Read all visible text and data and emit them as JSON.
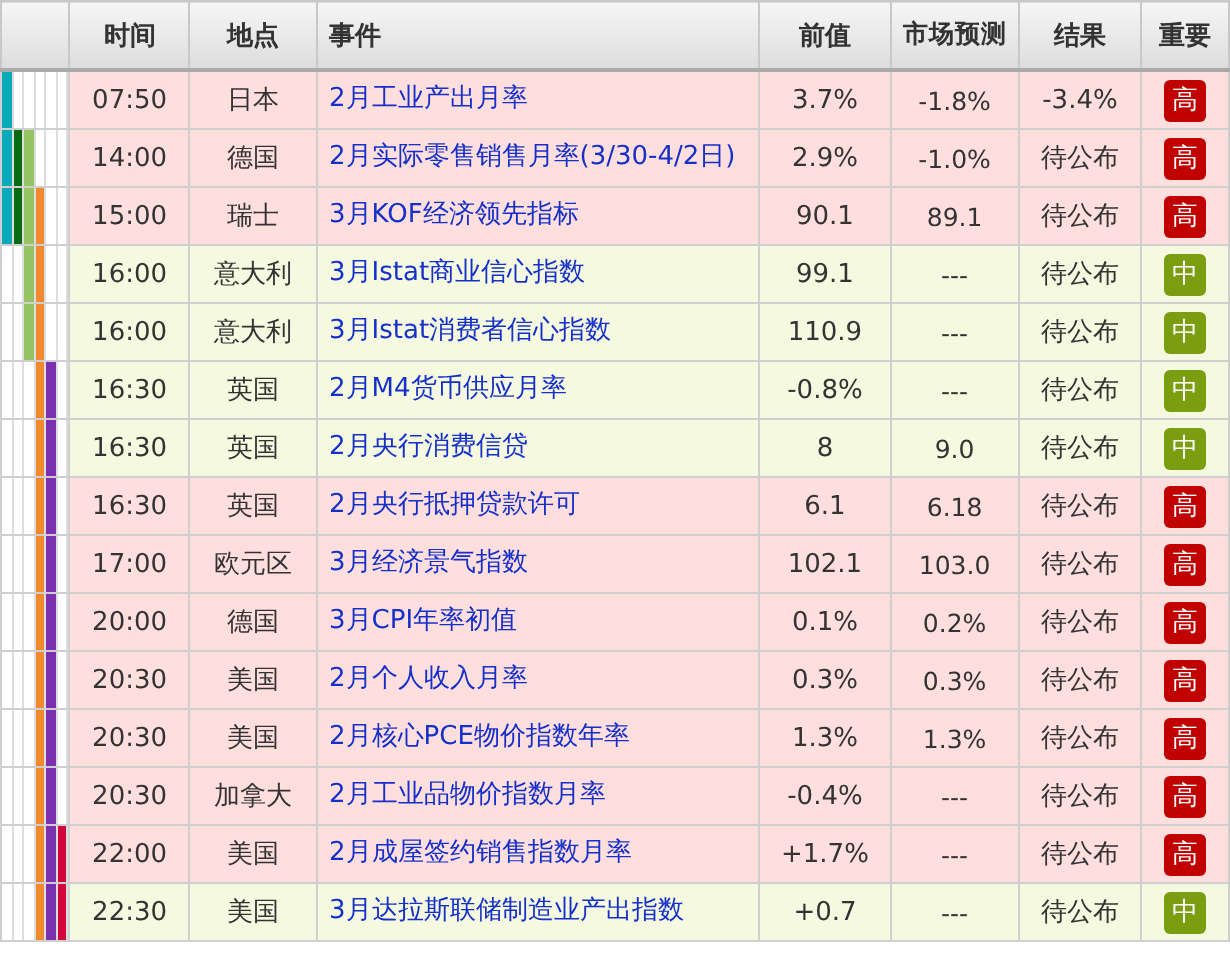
{
  "columns": [
    "时间",
    "地点",
    "事件",
    "前值",
    "市场预测",
    "结果",
    "重要"
  ],
  "lanes": [
    {
      "color": "#0aa9b9"
    },
    {
      "color": "#0b6b10"
    },
    {
      "color": "#97c462"
    },
    {
      "color": "#f08a2c"
    },
    {
      "color": "#7b30b0"
    },
    {
      "color": "#d0063c"
    }
  ],
  "rows": [
    {
      "lanes": [
        {
          "on": true
        },
        {
          "on": false
        },
        {
          "on": false
        },
        {
          "on": false
        },
        {
          "on": false
        },
        {
          "on": false
        }
      ],
      "time": "07:50",
      "place": "日本",
      "event": "2月工业产出月率",
      "previous": "3.7%",
      "forecast": "-1.8%",
      "result": "-3.4%",
      "importance": "高",
      "kind": "high"
    },
    {
      "lanes": [
        {
          "on": true
        },
        {
          "on": true
        },
        {
          "on": true
        },
        {
          "on": false
        },
        {
          "on": false
        },
        {
          "on": false
        }
      ],
      "time": "14:00",
      "place": "德国",
      "event": "2月实际零售销售月率(3/30-4/2日)",
      "previous": "2.9%",
      "forecast": "-1.0%",
      "result": "待公布",
      "importance": "高",
      "kind": "high"
    },
    {
      "lanes": [
        {
          "on": true
        },
        {
          "on": true
        },
        {
          "on": true
        },
        {
          "on": true
        },
        {
          "on": false
        },
        {
          "on": false
        }
      ],
      "time": "15:00",
      "place": "瑞士",
      "event": "3月KOF经济领先指标",
      "previous": "90.1",
      "forecast": "89.1",
      "result": "待公布",
      "importance": "高",
      "kind": "high"
    },
    {
      "lanes": [
        {
          "on": false
        },
        {
          "on": false
        },
        {
          "on": true
        },
        {
          "on": true
        },
        {
          "on": false
        },
        {
          "on": false
        }
      ],
      "time": "16:00",
      "place": "意大利",
      "event": "3月Istat商业信心指数",
      "previous": "99.1",
      "forecast": "---",
      "result": "待公布",
      "importance": "中",
      "kind": "medium"
    },
    {
      "lanes": [
        {
          "on": false
        },
        {
          "on": false
        },
        {
          "on": true
        },
        {
          "on": true
        },
        {
          "on": false
        },
        {
          "on": false
        }
      ],
      "time": "16:00",
      "place": "意大利",
      "event": "3月Istat消费者信心指数",
      "previous": "110.9",
      "forecast": "---",
      "result": "待公布",
      "importance": "中",
      "kind": "medium"
    },
    {
      "lanes": [
        {
          "on": false
        },
        {
          "on": false
        },
        {
          "on": false
        },
        {
          "on": true
        },
        {
          "on": true
        },
        {
          "on": false
        }
      ],
      "time": "16:30",
      "place": "英国",
      "event": "2月M4货币供应月率",
      "previous": "-0.8%",
      "forecast": "---",
      "result": "待公布",
      "importance": "中",
      "kind": "medium"
    },
    {
      "lanes": [
        {
          "on": false
        },
        {
          "on": false
        },
        {
          "on": false
        },
        {
          "on": true
        },
        {
          "on": true
        },
        {
          "on": false
        }
      ],
      "time": "16:30",
      "place": "英国",
      "event": "2月央行消费信贷",
      "previous": "8",
      "forecast": "9.0",
      "result": "待公布",
      "importance": "中",
      "kind": "medium"
    },
    {
      "lanes": [
        {
          "on": false
        },
        {
          "on": false
        },
        {
          "on": false
        },
        {
          "on": true
        },
        {
          "on": true
        },
        {
          "on": false
        }
      ],
      "time": "16:30",
      "place": "英国",
      "event": "2月央行抵押贷款许可",
      "previous": "6.1",
      "forecast": "6.18",
      "result": "待公布",
      "importance": "高",
      "kind": "high"
    },
    {
      "lanes": [
        {
          "on": false
        },
        {
          "on": false
        },
        {
          "on": false
        },
        {
          "on": true
        },
        {
          "on": true
        },
        {
          "on": false
        }
      ],
      "time": "17:00",
      "place": "欧元区",
      "event": "3月经济景气指数",
      "previous": "102.1",
      "forecast": "103.0",
      "result": "待公布",
      "importance": "高",
      "kind": "high"
    },
    {
      "lanes": [
        {
          "on": false
        },
        {
          "on": false
        },
        {
          "on": false
        },
        {
          "on": true
        },
        {
          "on": true
        },
        {
          "on": false
        }
      ],
      "time": "20:00",
      "place": "德国",
      "event": "3月CPI年率初值",
      "previous": "0.1%",
      "forecast": "0.2%",
      "result": "待公布",
      "importance": "高",
      "kind": "high"
    },
    {
      "lanes": [
        {
          "on": false
        },
        {
          "on": false
        },
        {
          "on": false
        },
        {
          "on": true
        },
        {
          "on": true
        },
        {
          "on": false
        }
      ],
      "time": "20:30",
      "place": "美国",
      "event": "2月个人收入月率",
      "previous": "0.3%",
      "forecast": "0.3%",
      "result": "待公布",
      "importance": "高",
      "kind": "high"
    },
    {
      "lanes": [
        {
          "on": false
        },
        {
          "on": false
        },
        {
          "on": false
        },
        {
          "on": true
        },
        {
          "on": true
        },
        {
          "on": false
        }
      ],
      "time": "20:30",
      "place": "美国",
      "event": "2月核心PCE物价指数年率",
      "previous": "1.3%",
      "forecast": "1.3%",
      "result": "待公布",
      "importance": "高",
      "kind": "high"
    },
    {
      "lanes": [
        {
          "on": false
        },
        {
          "on": false
        },
        {
          "on": false
        },
        {
          "on": true
        },
        {
          "on": true
        },
        {
          "on": false
        }
      ],
      "time": "20:30",
      "place": "加拿大",
      "event": "2月工业品物价指数月率",
      "previous": "-0.4%",
      "forecast": "---",
      "result": "待公布",
      "importance": "高",
      "kind": "high"
    },
    {
      "lanes": [
        {
          "on": false
        },
        {
          "on": false
        },
        {
          "on": false
        },
        {
          "on": true
        },
        {
          "on": true
        },
        {
          "on": true
        }
      ],
      "time": "22:00",
      "place": "美国",
      "event": "2月成屋签约销售指数月率",
      "previous": "+1.7%",
      "forecast": "---",
      "result": "待公布",
      "importance": "高",
      "kind": "high"
    },
    {
      "lanes": [
        {
          "on": false
        },
        {
          "on": false
        },
        {
          "on": false
        },
        {
          "on": true
        },
        {
          "on": true
        },
        {
          "on": true
        }
      ],
      "time": "22:30",
      "place": "美国",
      "event": "3月达拉斯联储制造业产出指数",
      "previous": "+0.7",
      "forecast": "---",
      "result": "待公布",
      "importance": "中",
      "kind": "medium"
    }
  ]
}
